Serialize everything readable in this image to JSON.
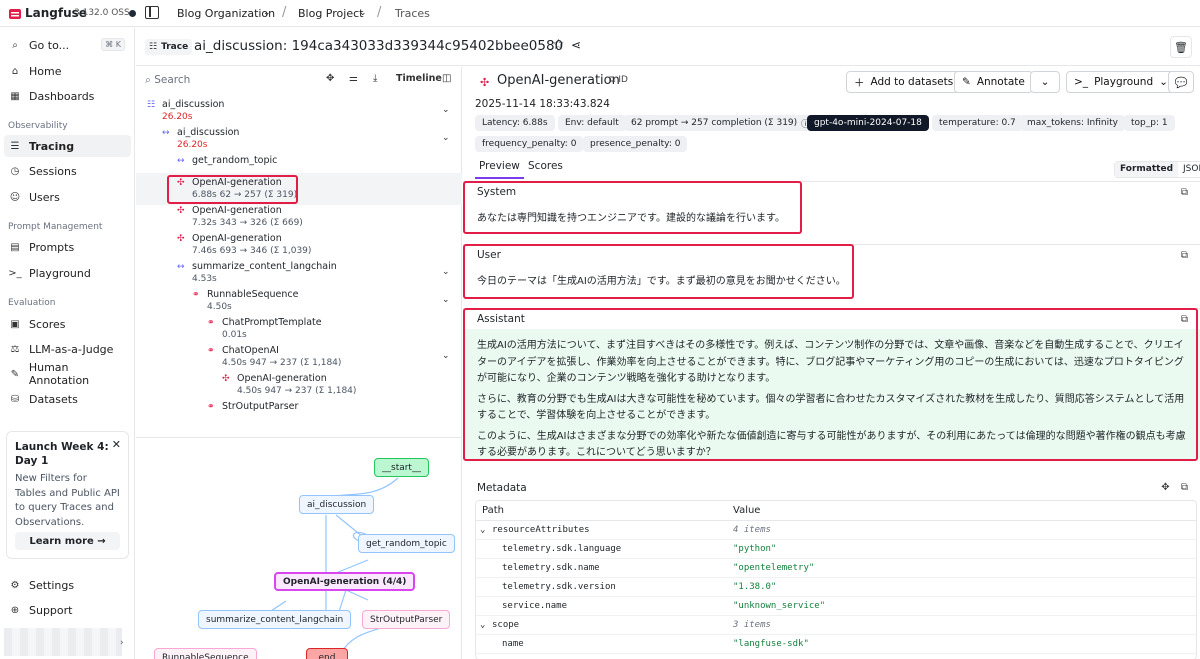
{
  "app": {
    "logo_text": "Langfuse",
    "version": "3.132.0 OSS",
    "breadcrumb": [
      "Blog Organization",
      "Blog Project",
      "Traces"
    ]
  },
  "sidebar": {
    "goto": {
      "label": "Go to...",
      "shortcut": "⌘ K"
    },
    "top_items": [
      {
        "label": "Home",
        "icon": "home-icon"
      },
      {
        "label": "Dashboards",
        "icon": "dashboard-icon"
      }
    ],
    "sections": [
      {
        "title": "Observability",
        "items": [
          {
            "label": "Tracing",
            "icon": "tracing-icon",
            "active": true
          },
          {
            "label": "Sessions",
            "icon": "sessions-icon"
          },
          {
            "label": "Users",
            "icon": "users-icon"
          }
        ]
      },
      {
        "title": "Prompt Management",
        "items": [
          {
            "label": "Prompts",
            "icon": "prompts-icon"
          },
          {
            "label": "Playground",
            "icon": "terminal-icon"
          }
        ]
      },
      {
        "title": "Evaluation",
        "items": [
          {
            "label": "Scores",
            "icon": "scores-icon"
          },
          {
            "label": "LLM-as-a-Judge",
            "icon": "judge-icon"
          },
          {
            "label": "Human Annotation",
            "icon": "annotation-icon"
          },
          {
            "label": "Datasets",
            "icon": "datasets-icon"
          }
        ]
      }
    ],
    "promo": {
      "title": "Launch Week 4: Day 1",
      "text": "New Filters for Tables and Public API to query Traces and Observations.",
      "button": "Learn more →"
    },
    "bottom_items": [
      {
        "label": "Settings",
        "icon": "settings-icon"
      },
      {
        "label": "Support",
        "icon": "support-icon"
      }
    ]
  },
  "trace": {
    "badge": "Trace",
    "title": "ai_discussion: 194ca343033d339344c95402bbee0580"
  },
  "tree": {
    "search_placeholder": "Search",
    "timeline_label": "Timeline",
    "nodes": [
      {
        "name": "ai_discussion",
        "meta": "26.20s",
        "meta_red": true,
        "type": "trace"
      },
      {
        "name": "ai_discussion",
        "meta": "26.20s",
        "meta_red": true,
        "type": "span"
      },
      {
        "name": "get_random_topic",
        "meta": "",
        "type": "span"
      },
      {
        "name": "OpenAI-generation",
        "meta": "6.88s  62 → 257 (Σ 319)",
        "type": "generation"
      },
      {
        "name": "OpenAI-generation",
        "meta": "7.32s  343 → 326 (Σ 669)",
        "type": "generation"
      },
      {
        "name": "OpenAI-generation",
        "meta": "7.46s  693 → 346 (Σ 1,039)",
        "type": "generation"
      },
      {
        "name": "summarize_content_langchain",
        "meta": "4.53s",
        "type": "span"
      },
      {
        "name": "RunnableSequence",
        "meta": "4.50s",
        "type": "chain"
      },
      {
        "name": "ChatPromptTemplate",
        "meta": "0.01s",
        "type": "chain"
      },
      {
        "name": "ChatOpenAI",
        "meta": "4.50s  947 → 237 (Σ 1,184)",
        "type": "chain"
      },
      {
        "name": "OpenAI-generation",
        "meta": "4.50s  947 → 237 (Σ 1,184)",
        "type": "generation"
      },
      {
        "name": "StrOutputParser",
        "meta": "",
        "type": "chain"
      }
    ]
  },
  "graph": {
    "nodes": [
      "__start__",
      "ai_discussion",
      "get_random_topic",
      "OpenAI-generation (4/4)",
      "summarize_content_langchain",
      "StrOutputParser",
      "RunnableSequence",
      "_end_"
    ]
  },
  "generation": {
    "name": "OpenAI-generation",
    "id_label": "ID",
    "timestamp": "2025-11-14 18:33:43.824",
    "buttons": {
      "add_to_datasets": "Add to datasets",
      "annotate": "Annotate",
      "playground": "Playground"
    },
    "chips": [
      "Latency: 6.88s",
      "Env: default",
      "62 prompt → 257 completion (Σ 319)",
      "gpt-4o-mini-2024-07-18",
      "temperature: 0.7",
      "max_tokens: Infinity",
      "top_p: 1",
      "frequency_penalty: 0",
      "presence_penalty: 0"
    ],
    "tabs": [
      "Preview",
      "Scores"
    ],
    "format": {
      "formatted": "Formatted",
      "json": "JSON"
    },
    "messages": [
      {
        "role": "System",
        "content": "あなたは専門知識を持つエンジニアです。建設的な議論を行います。"
      },
      {
        "role": "User",
        "content": "今日のテーマは「生成AIの活用方法」です。まず最初の意見をお聞かせください。"
      },
      {
        "role": "Assistant",
        "paragraphs": [
          "生成AIの活用方法について、まず注目すべきはその多様性です。例えば、コンテンツ制作の分野では、文章や画像、音楽などを自動生成することで、クリエイターのアイデアを拡張し、作業効率を向上させることができます。特に、ブログ記事やマーケティング用のコピーの生成においては、迅速なプロトタイピングが可能になり、企業のコンテンツ戦略を強化する助けとなります。",
          "さらに、教育の分野でも生成AIは大きな可能性を秘めています。個々の学習者に合わせたカスタマイズされた教材を生成したり、質問応答システムとして活用することで、学習体験を向上させることができます。",
          "このように、生成AIはさまざまな分野での効率化や新たな価値創造に寄与する可能性がありますが、その利用にあたっては倫理的な問題や著作権の観点も考慮する必要があります。これについてどう思いますか？"
        ]
      }
    ],
    "metadata": {
      "title": "Metadata",
      "columns": [
        "Path",
        "Value"
      ],
      "rows": [
        {
          "key": "resourceAttributes",
          "value": "4 items",
          "group": true
        },
        {
          "key": "telemetry.sdk.language",
          "value": "\"python\""
        },
        {
          "key": "telemetry.sdk.name",
          "value": "\"opentelemetry\""
        },
        {
          "key": "telemetry.sdk.version",
          "value": "\"1.38.0\""
        },
        {
          "key": "service.name",
          "value": "\"unknown_service\""
        },
        {
          "key": "scope",
          "value": "3 items",
          "group": true
        },
        {
          "key": "name",
          "value": "\"langfuse-sdk\""
        }
      ]
    }
  }
}
